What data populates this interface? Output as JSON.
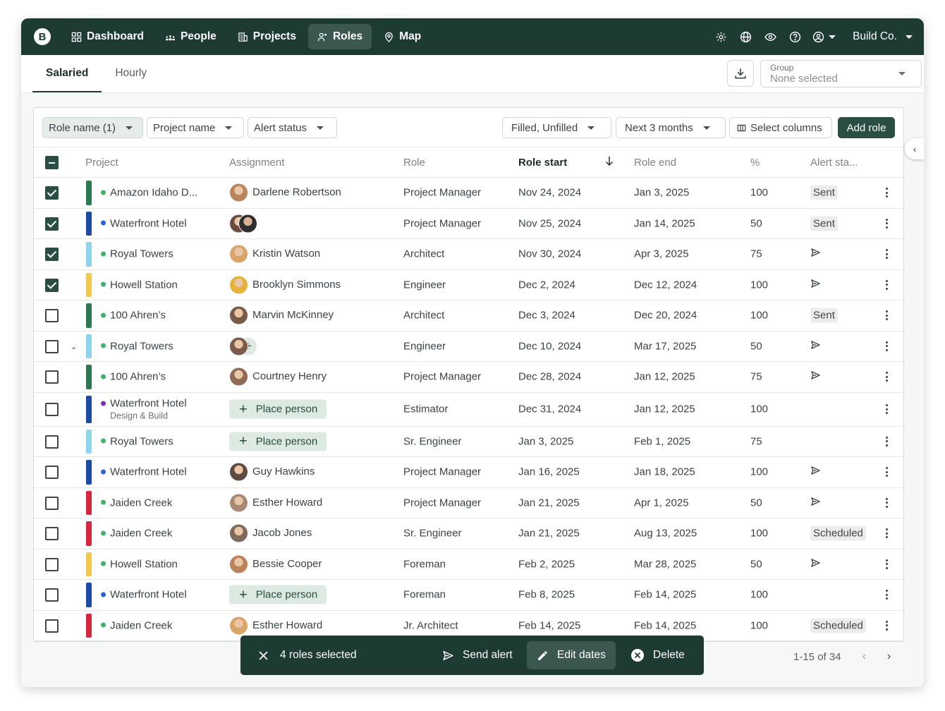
{
  "nav": {
    "logo": "B",
    "items": [
      {
        "label": "Dashboard",
        "icon": "grid-icon"
      },
      {
        "label": "People",
        "icon": "people-icon"
      },
      {
        "label": "Projects",
        "icon": "building-icon"
      },
      {
        "label": "Roles",
        "icon": "roles-icon"
      },
      {
        "label": "Map",
        "icon": "map-pin-icon"
      }
    ],
    "company": "Build Co."
  },
  "subheader": {
    "tabs": [
      "Salaried",
      "Hourly"
    ],
    "group_label": "Group",
    "group_value": "None selected"
  },
  "filters": {
    "role_name": "Role name (1)",
    "project_name": "Project name",
    "alert_status": "Alert status",
    "filled": "Filled, Unfilled",
    "range": "Next 3 months",
    "select_columns": "Select columns",
    "add_role": "Add role"
  },
  "columns": [
    "Project",
    "Assignment",
    "Role",
    "Role start",
    "Role end",
    "%",
    "Alert sta..."
  ],
  "rows": [
    {
      "checked": true,
      "bar": "#2e7a4f",
      "dot": "#3cb36b",
      "project": "Amazon Idaho D...",
      "assign": "Darlene Robertson",
      "avatars": 1,
      "role": "Project Manager",
      "start": "Nov 24, 2024",
      "end": "Jan 3, 2025",
      "pct": "100",
      "alert": "Sent"
    },
    {
      "checked": true,
      "bar": "#1b4aa8",
      "dot": "#2563d9",
      "project": "Waterfront Hotel",
      "assign": "",
      "avatars": 2,
      "role": "Project Manager",
      "start": "Nov 25, 2024",
      "end": "Jan 14, 2025",
      "pct": "50",
      "alert": "Sent"
    },
    {
      "checked": true,
      "bar": "#8fd3ef",
      "dot": "#3cb36b",
      "project": "Royal Towers",
      "assign": "Kristin Watson",
      "avatars": 1,
      "role": "Architect",
      "start": "Nov 30, 2024",
      "end": "Apr 3, 2025",
      "pct": "75",
      "alert": "send"
    },
    {
      "checked": true,
      "bar": "#f2c94c",
      "dot": "#3cb36b",
      "project": "Howell Station",
      "assign": "Brooklyn Simmons",
      "avatars": 1,
      "role": "Engineer",
      "start": "Dec 2, 2024",
      "end": "Dec 12, 2024",
      "pct": "100",
      "alert": "send"
    },
    {
      "checked": false,
      "bar": "#2e7a4f",
      "dot": "#3cb36b",
      "project": "100 Ahren’s",
      "assign": "Marvin McKinney",
      "avatars": 1,
      "role": "Architect",
      "start": "Dec 3, 2024",
      "end": "Dec 20, 2024",
      "pct": "100",
      "alert": "Sent"
    },
    {
      "checked": false,
      "bar": "#8fd3ef",
      "dot": "#3cb36b",
      "project": "Royal Towers",
      "assign": "",
      "avatars": 3,
      "role": "Engineer",
      "start": "Dec 10, 2024",
      "end": "Mar 17, 2025",
      "pct": "50",
      "alert": "send",
      "expand": true
    },
    {
      "checked": false,
      "bar": "#2e7a4f",
      "dot": "#3cb36b",
      "project": "100 Ahren’s",
      "assign": "Courtney Henry",
      "avatars": 1,
      "role": "Project Manager",
      "start": "Dec 28, 2024",
      "end": "Jan 12, 2025",
      "pct": "75",
      "alert": "send"
    },
    {
      "checked": false,
      "bar": "#1b4aa8",
      "dot": "#7b2fb8",
      "project": "Waterfront Hotel",
      "sub": "Design & Build",
      "assign": "Place person",
      "avatars": 0,
      "role": "Estimator",
      "start": "Dec 31, 2024",
      "end": "Jan 12, 2025",
      "pct": "100",
      "alert": ""
    },
    {
      "checked": false,
      "bar": "#8fd3ef",
      "dot": "#3cb36b",
      "project": "Royal Towers",
      "assign": "Place person",
      "avatars": 0,
      "role": "Sr. Engineer",
      "start": "Jan 3, 2025",
      "end": "Feb 1, 2025",
      "pct": "75",
      "alert": ""
    },
    {
      "checked": false,
      "bar": "#1b4aa8",
      "dot": "#2563d9",
      "project": "Waterfront Hotel",
      "assign": "Guy Hawkins",
      "avatars": 1,
      "role": "Project Manager",
      "start": "Jan 16, 2025",
      "end": "Jan 18, 2025",
      "pct": "100",
      "alert": "send"
    },
    {
      "checked": false,
      "bar": "#d7263d",
      "dot": "#3cb36b",
      "project": "Jaiden Creek",
      "assign": "Esther Howard",
      "avatars": 1,
      "role": "Project Manager",
      "start": "Jan 21, 2025",
      "end": "Apr 1, 2025",
      "pct": "50",
      "alert": "send"
    },
    {
      "checked": false,
      "bar": "#d7263d",
      "dot": "#3cb36b",
      "project": "Jaiden Creek",
      "assign": "Jacob Jones",
      "avatars": 1,
      "role": "Sr. Engineer",
      "start": "Jan 21, 2025",
      "end": "Aug 13, 2025",
      "pct": "100",
      "alert": "Scheduled"
    },
    {
      "checked": false,
      "bar": "#f2c94c",
      "dot": "#3cb36b",
      "project": "Howell Station",
      "assign": "Bessie Cooper",
      "avatars": 1,
      "role": "Foreman",
      "start": "Feb 2, 2025",
      "end": "Mar 28, 2025",
      "pct": "50",
      "alert": "send"
    },
    {
      "checked": false,
      "bar": "#1b4aa8",
      "dot": "#2563d9",
      "project": "Waterfront Hotel",
      "assign": "Place person",
      "avatars": 0,
      "role": "Foreman",
      "start": "Feb 8, 2025",
      "end": "Feb 14, 2025",
      "pct": "100",
      "alert": ""
    },
    {
      "checked": false,
      "bar": "#d7263d",
      "dot": "#3cb36b",
      "project": "Jaiden Creek",
      "assign": "Esther Howard",
      "avatars": 1,
      "role": "Jr. Architect",
      "start": "Feb 14, 2025",
      "end": "Feb 14, 2025",
      "pct": "100",
      "alert": "Scheduled"
    }
  ],
  "actionbar": {
    "selected": "4 roles selected",
    "send_alert": "Send alert",
    "edit_dates": "Edit dates",
    "delete": "Delete"
  },
  "pagination": "1-15 of 34"
}
